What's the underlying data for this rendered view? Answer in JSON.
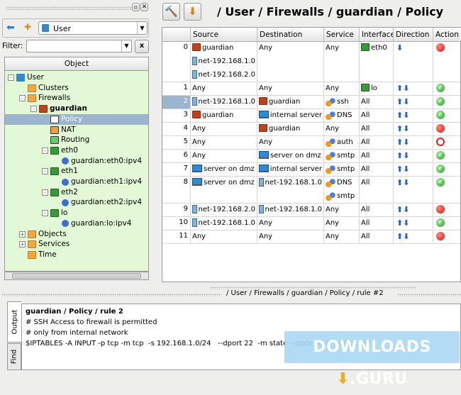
{
  "left_panel": {
    "library": "User",
    "filter_label": "Filter:",
    "filter_value": "",
    "clear_label": "x",
    "column_header": "Object",
    "tree": [
      {
        "label": "User",
        "depth": 0,
        "icon": "library-icon",
        "exp": "-"
      },
      {
        "label": "Clusters",
        "depth": 1,
        "icon": "folder-icon"
      },
      {
        "label": "Firewalls",
        "depth": 1,
        "icon": "folder-icon",
        "exp": "-"
      },
      {
        "label": "guardian",
        "depth": 2,
        "icon": "firewall-icon",
        "exp": "-",
        "bold": true
      },
      {
        "label": "Policy",
        "depth": 3,
        "icon": "policy-icon",
        "selected": true
      },
      {
        "label": "NAT",
        "depth": 3,
        "icon": "nat-icon"
      },
      {
        "label": "Routing",
        "depth": 3,
        "icon": "routing-icon"
      },
      {
        "label": "eth0",
        "depth": 3,
        "icon": "interface-icon",
        "exp": "-"
      },
      {
        "label": "guardian:eth0:ipv4",
        "depth": 4,
        "icon": "address-icon"
      },
      {
        "label": "eth1",
        "depth": 3,
        "icon": "interface-icon",
        "exp": "-"
      },
      {
        "label": "guardian:eth1:ipv4",
        "depth": 4,
        "icon": "address-icon"
      },
      {
        "label": "eth2",
        "depth": 3,
        "icon": "interface-icon",
        "exp": "-"
      },
      {
        "label": "guardian:eth2:ipv4",
        "depth": 4,
        "icon": "address-icon"
      },
      {
        "label": "lo",
        "depth": 3,
        "icon": "interface-icon",
        "exp": "-"
      },
      {
        "label": "guardian:lo:ipv4",
        "depth": 4,
        "icon": "address-icon"
      },
      {
        "label": "Objects",
        "depth": 1,
        "icon": "folder-icon",
        "exp": "+"
      },
      {
        "label": "Services",
        "depth": 1,
        "icon": "folder-icon",
        "exp": "+"
      },
      {
        "label": "Time",
        "depth": 1,
        "icon": "folder-icon"
      }
    ]
  },
  "header": {
    "breadcrumb": "/ User / Firewalls / guardian / Policy"
  },
  "columns": [
    "Source",
    "Destination",
    "Service",
    "Interface",
    "Direction",
    "Action"
  ],
  "rules": [
    {
      "n": "0",
      "src": [
        [
          "firewall",
          "guardian"
        ],
        [
          "net",
          "net-192.168.1.0"
        ],
        [
          "net",
          "net-192.168.2.0"
        ]
      ],
      "dst": [
        [
          "",
          "Any"
        ]
      ],
      "svc": [
        [
          "",
          "Any"
        ]
      ],
      "itf": [
        [
          "iface",
          "eth0"
        ]
      ],
      "dir": "inbound",
      "act": "deny"
    },
    {
      "n": "1",
      "src": [
        [
          "",
          "Any"
        ]
      ],
      "dst": [
        [
          "",
          "Any"
        ]
      ],
      "svc": [
        [
          "",
          "Any"
        ]
      ],
      "itf": [
        [
          "iface",
          "lo"
        ]
      ],
      "dir": "both",
      "act": "accept"
    },
    {
      "n": "2",
      "src": [
        [
          "net",
          "net-192.168.1.0"
        ]
      ],
      "dst": [
        [
          "firewall",
          "guardian"
        ]
      ],
      "svc": [
        [
          "svc",
          "ssh"
        ]
      ],
      "itf": [
        [
          "",
          "All"
        ]
      ],
      "dir": "both",
      "act": "accept",
      "selected": true
    },
    {
      "n": "3",
      "src": [
        [
          "firewall",
          "guardian"
        ]
      ],
      "dst": [
        [
          "host",
          "internal server"
        ]
      ],
      "svc": [
        [
          "svc",
          "DNS"
        ]
      ],
      "itf": [
        [
          "",
          "All"
        ]
      ],
      "dir": "both",
      "act": "accept"
    },
    {
      "n": "4",
      "src": [
        [
          "",
          "Any"
        ]
      ],
      "dst": [
        [
          "firewall",
          "guardian"
        ]
      ],
      "svc": [
        [
          "",
          "Any"
        ]
      ],
      "itf": [
        [
          "",
          "All"
        ]
      ],
      "dir": "both",
      "act": "deny"
    },
    {
      "n": "5",
      "src": [
        [
          "",
          "Any"
        ]
      ],
      "dst": [
        [
          "",
          "Any"
        ]
      ],
      "svc": [
        [
          "svc",
          "auth"
        ]
      ],
      "itf": [
        [
          "",
          "All"
        ]
      ],
      "dir": "both",
      "act": "reject"
    },
    {
      "n": "6",
      "src": [
        [
          "",
          "Any"
        ]
      ],
      "dst": [
        [
          "host",
          "server on dmz"
        ]
      ],
      "svc": [
        [
          "svc",
          "smtp"
        ]
      ],
      "itf": [
        [
          "",
          "All"
        ]
      ],
      "dir": "both",
      "act": "accept"
    },
    {
      "n": "7",
      "src": [
        [
          "host",
          "server on dmz"
        ]
      ],
      "dst": [
        [
          "host",
          "internal server"
        ]
      ],
      "svc": [
        [
          "svc",
          "smtp"
        ]
      ],
      "itf": [
        [
          "",
          "All"
        ]
      ],
      "dir": "both",
      "act": "accept"
    },
    {
      "n": "8",
      "src": [
        [
          "host",
          "server on dmz"
        ]
      ],
      "dst": [
        [
          "netneg",
          "net-192.168.1.0"
        ]
      ],
      "svc": [
        [
          "svc",
          "DNS"
        ],
        [
          "svc",
          "smtp"
        ]
      ],
      "itf": [
        [
          "",
          "All"
        ]
      ],
      "dir": "both",
      "act": "accept"
    },
    {
      "n": "9",
      "src": [
        [
          "net",
          "net-192.168.2.0"
        ]
      ],
      "dst": [
        [
          "net",
          "net-192.168.1.0"
        ]
      ],
      "svc": [
        [
          "",
          "Any"
        ]
      ],
      "itf": [
        [
          "",
          "All"
        ]
      ],
      "dir": "both",
      "act": "deny"
    },
    {
      "n": "10",
      "src": [
        [
          "net",
          "net-192.168.1.0"
        ]
      ],
      "dst": [
        [
          "",
          "Any"
        ]
      ],
      "svc": [
        [
          "",
          "Any"
        ]
      ],
      "itf": [
        [
          "",
          "All"
        ]
      ],
      "dir": "both",
      "act": "accept"
    },
    {
      "n": "11",
      "src": [
        [
          "",
          "Any"
        ]
      ],
      "dst": [
        [
          "",
          "Any"
        ]
      ],
      "svc": [
        [
          "",
          "Any"
        ]
      ],
      "itf": [
        [
          "",
          "All"
        ]
      ],
      "dir": "both",
      "act": "deny"
    }
  ],
  "status_path": "/ User / Firewalls / guardian / Policy / rule #2",
  "output": {
    "tabs": [
      "Output",
      "Find"
    ],
    "title": "guardian / Policy / rule 2",
    "lines": [
      "# SSH Access to firewall is permitted",
      "# only from internal network",
      "$IPTABLES -A INPUT -p tcp -m tcp  -s 192.168.1.0/24   --dport 22  -m state --state NEW  -j ACCEPT"
    ]
  },
  "watermark": "DOWNLOADS GURU"
}
